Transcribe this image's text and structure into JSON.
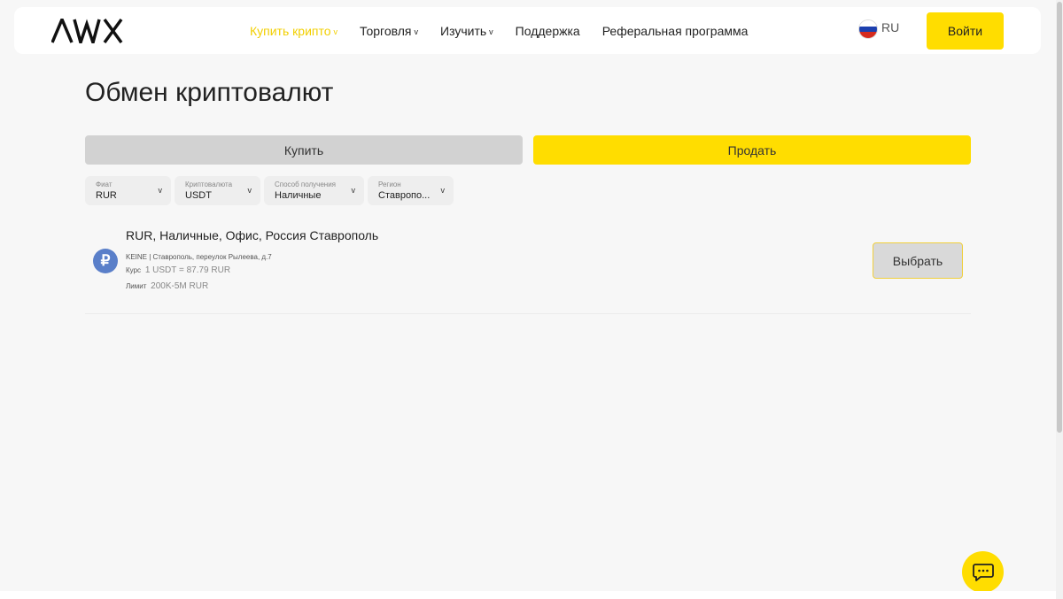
{
  "header": {
    "logo_text": "AWX",
    "nav": [
      {
        "label": "Купить крипто",
        "has_dropdown": true,
        "active": true
      },
      {
        "label": "Торговля",
        "has_dropdown": true,
        "active": false
      },
      {
        "label": "Изучить",
        "has_dropdown": true,
        "active": false
      },
      {
        "label": "Поддержка",
        "has_dropdown": false,
        "active": false
      },
      {
        "label": "Реферальная программа",
        "has_dropdown": false,
        "active": false
      }
    ],
    "language": "RU",
    "login_label": "Войти"
  },
  "main": {
    "title": "Обмен криптовалют",
    "tabs": {
      "buy": "Купить",
      "sell": "Продать",
      "active": "sell"
    },
    "filters": [
      {
        "label": "Фиат",
        "value": "RUR"
      },
      {
        "label": "Криптовалюта",
        "value": "USDT"
      },
      {
        "label": "Способ получения",
        "value": "Наличные"
      },
      {
        "label": "Регион",
        "value": "Ставропо..."
      }
    ],
    "offers": [
      {
        "icon_symbol": "₽",
        "title": "RUR, Наличные, Офис, Россия Ставрополь",
        "address": "KEINE | Ставрополь, переулок Рылеева, д.7",
        "rate_label": "Курс",
        "rate_value": "1 USDT = 87.79 RUR",
        "limit_label": "Лимит",
        "limit_value": "200K-5M RUR",
        "select_label": "Выбрать"
      }
    ]
  },
  "icons": {
    "dropdown": "chevron-down-icon",
    "language_flag": "russia-flag-icon",
    "currency": "ruble-icon",
    "chat": "chat-icon"
  },
  "colors": {
    "accent": "#ffdd00",
    "active_nav": "#f2cf00",
    "ruble_badge": "#5a7fc9",
    "background": "#f7f7f7"
  }
}
